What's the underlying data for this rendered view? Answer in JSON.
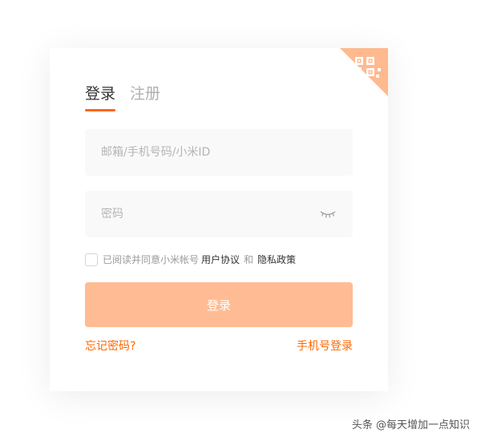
{
  "tabs": [
    {
      "label": "登录",
      "active": true
    },
    {
      "label": "注册",
      "active": false
    }
  ],
  "form": {
    "account_placeholder": "邮箱/手机号码/小米ID",
    "password_placeholder": "密码"
  },
  "agreement": {
    "prefix": "已阅读并同意小米帐号",
    "user_agreement": "用户协议",
    "and": "和",
    "privacy_policy": "隐私政策"
  },
  "login_button": "登录",
  "links": {
    "forgot_password": "忘记密码?",
    "phone_login": "手机号登录"
  },
  "watermark": "头条 @每天增加一点知识",
  "icons": {
    "corner": "qr-code-icon",
    "password_toggle": "eye-closed-icon"
  },
  "colors": {
    "accent": "#ff6700",
    "button_disabled": "#ffbc94",
    "qr_corner": "#ffb98f",
    "field_bg": "#f9f9f9"
  }
}
